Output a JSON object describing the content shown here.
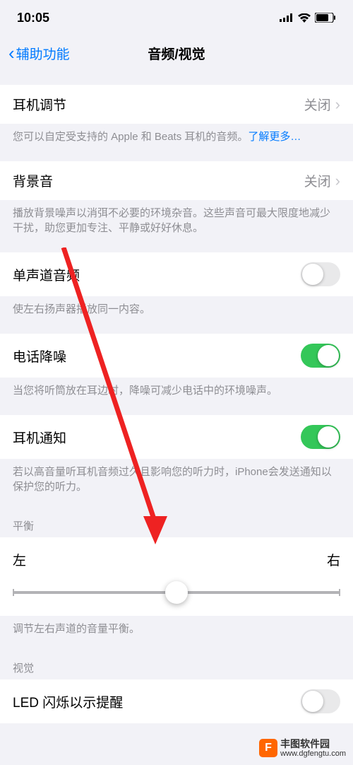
{
  "statusBar": {
    "time": "10:05"
  },
  "nav": {
    "back": "辅助功能",
    "title": "音频/视觉"
  },
  "sections": {
    "headphone": {
      "label": "耳机调节",
      "value": "关闭",
      "footer": "您可以自定受支持的 Apple 和 Beats 耳机的音频。",
      "link": "了解更多…"
    },
    "background": {
      "label": "背景音",
      "value": "关闭",
      "footer": "播放背景噪声以消弭不必要的环境杂音。这些声音可最大限度地减少干扰，助您更加专注、平静或好好休息。"
    },
    "mono": {
      "label": "单声道音频",
      "footer": "使左右扬声器播放同一内容。"
    },
    "noise": {
      "label": "电话降噪",
      "footer": "当您将听筒放在耳边时，降噪可减少电话中的环境噪声。"
    },
    "notify": {
      "label": "耳机通知",
      "footer": "若以高音量听耳机音频过久且影响您的听力时，iPhone会发送通知以保护您的听力。"
    },
    "balance": {
      "header": "平衡",
      "left": "左",
      "right": "右",
      "footer": "调节左右声道的音量平衡。"
    },
    "visual": {
      "header": "视觉",
      "led": "LED 闪烁以示提醒"
    }
  },
  "watermark": {
    "name": "丰图软件园",
    "url": "www.dgfengtu.com"
  }
}
